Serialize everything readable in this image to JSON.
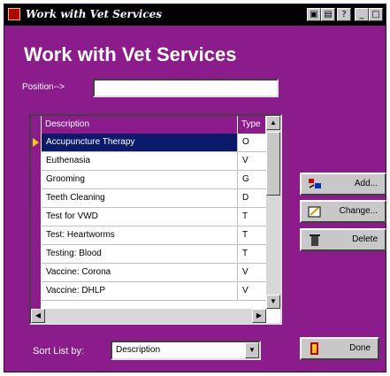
{
  "window": {
    "title": "Work with Vet Services",
    "controls": [
      "?",
      "_",
      "□",
      "×"
    ],
    "colors": {
      "background": "#8c1c8c",
      "selection": "#0c1a6c",
      "titlebar": "#000000"
    }
  },
  "heading": "Work with Vet Services",
  "position": {
    "label": "Position-->",
    "value": ""
  },
  "grid": {
    "columns": [
      "Description",
      "Type"
    ],
    "rows": [
      {
        "description": "Accupuncture Therapy",
        "type": "O"
      },
      {
        "description": "Euthenasia",
        "type": "V"
      },
      {
        "description": "Grooming",
        "type": "G"
      },
      {
        "description": "Teeth Cleaning",
        "type": "D"
      },
      {
        "description": "Test for VWD",
        "type": "T"
      },
      {
        "description": "Test: Heartworms",
        "type": "T"
      },
      {
        "description": "Testing: Blood",
        "type": "T"
      },
      {
        "description": "Vaccine: Corona",
        "type": "V"
      },
      {
        "description": "Vaccine: DHLP",
        "type": "V"
      }
    ]
  },
  "buttons": {
    "add": "Add...",
    "change": "Change...",
    "delete": "Delete",
    "done": "Done"
  },
  "sort": {
    "label": "Sort List by:",
    "value": "Description"
  }
}
